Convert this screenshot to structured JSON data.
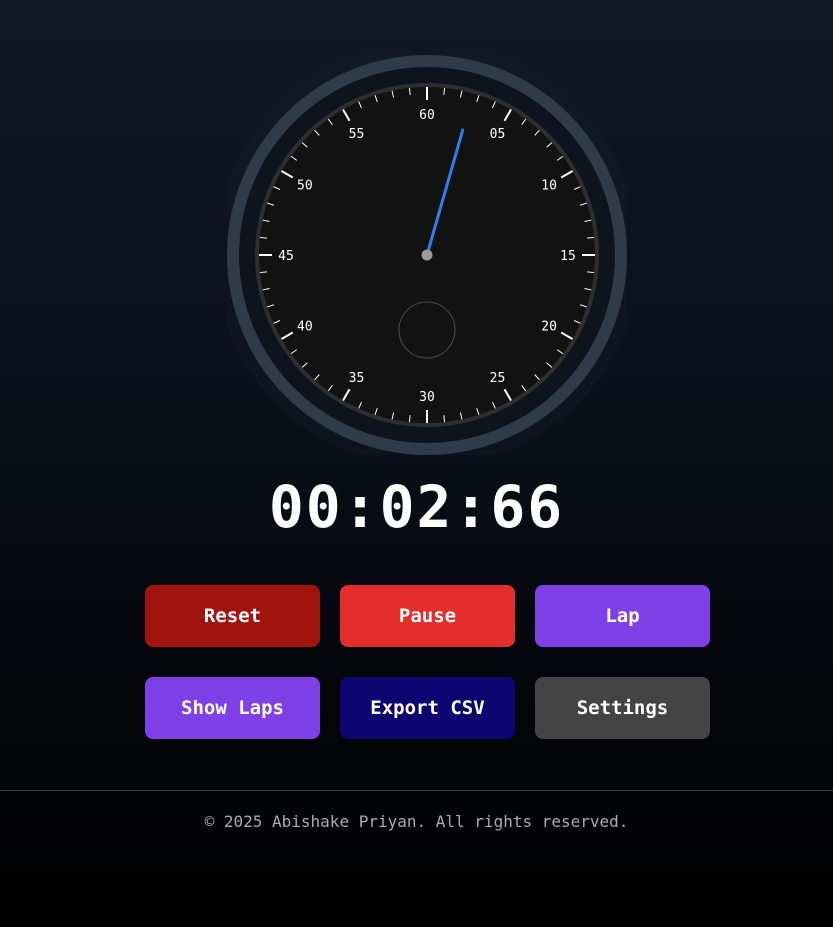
{
  "stopwatch": {
    "dial_numbers": [
      "60",
      "05",
      "10",
      "15",
      "20",
      "25",
      "30",
      "35",
      "40",
      "45",
      "50",
      "55"
    ],
    "second_hand_seconds": 2.66,
    "colors": {
      "bezel": "#303b4a",
      "face": "#121212",
      "rim": "#2e2e2e",
      "hand": "#2f80ed",
      "hub": "#9a9a9a",
      "ticks": "#ffffff",
      "subdial": "#4a4a4a"
    }
  },
  "time_display": "00:02:66",
  "buttons": [
    {
      "label": "Reset",
      "color": "#a1130d"
    },
    {
      "label": "Pause",
      "color": "#e42e2b"
    },
    {
      "label": "Lap",
      "color": "#8040e8"
    },
    {
      "label": "Show Laps",
      "color": "#8040e8"
    },
    {
      "label": "Export CSV",
      "color": "#0e0670"
    },
    {
      "label": "Settings",
      "color": "#444444"
    }
  ],
  "footer": {
    "text": "© 2025 Abishake Priyan. All rights reserved."
  }
}
